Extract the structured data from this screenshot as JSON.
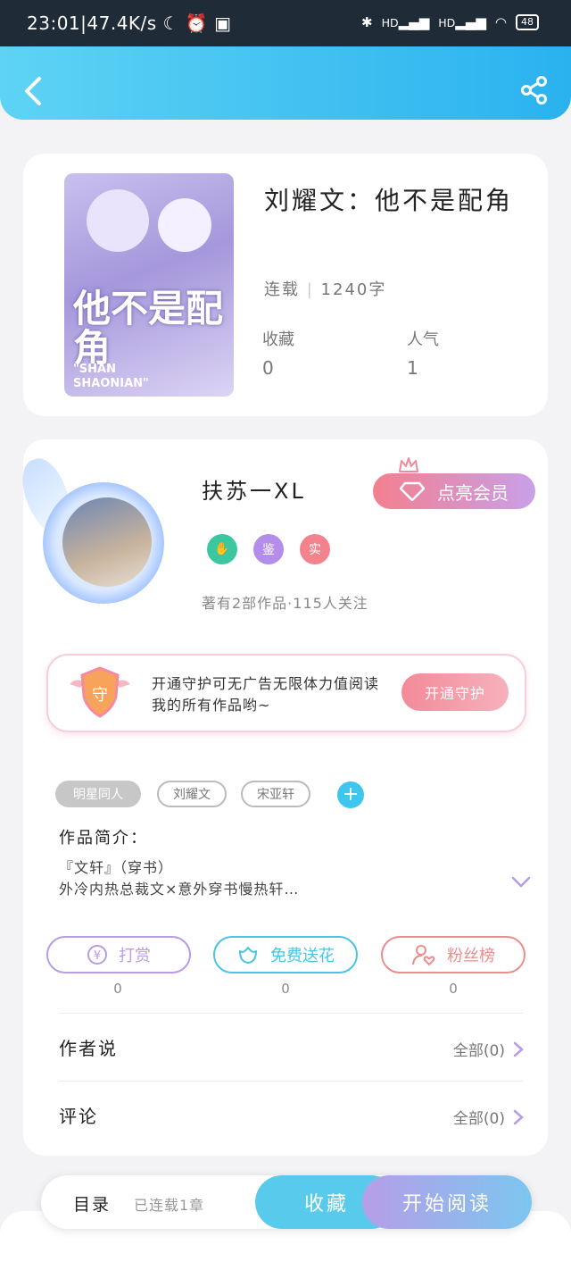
{
  "status_bar": {
    "time": "23:01",
    "speed": "47.4K/s",
    "battery": "48",
    "hd1": "HD",
    "hd2": "HD"
  },
  "book": {
    "title": "刘耀文：他不是配角",
    "status": "连载",
    "words": "1240字",
    "collect_label": "收藏",
    "collect_value": "0",
    "popularity_label": "人气",
    "popularity_value": "1",
    "cover_title": "他不是配角",
    "cover_subtitle_1": "\"SHAN",
    "cover_subtitle_2": "SHAONIAN\""
  },
  "author": {
    "name": "扶苏一XL",
    "vip_button": "点亮会员",
    "badges": [
      "",
      "鉴",
      "实"
    ],
    "works_info": "著有2部作品·115人关注"
  },
  "guard": {
    "text": "开通守护可无广告无限体力值阅读我的所有作品哟~",
    "button": "开通守护",
    "icon_char": "守"
  },
  "tags": [
    "明星同人",
    "刘耀文",
    "宋亚轩"
  ],
  "tag_add": "+",
  "intro": {
    "label": "作品简介：",
    "line1": "『文轩』（穿书）",
    "line2": "外冷内热总裁文×意外穿书慢热轩…"
  },
  "actions": [
    {
      "label": "打赏",
      "count": "0",
      "icon": "yen-coin-icon",
      "color": "#b99be6"
    },
    {
      "label": "免费送花",
      "count": "0",
      "icon": "flower-icon",
      "color": "#49c3e8"
    },
    {
      "label": "粉丝榜",
      "count": "0",
      "icon": "fan-heart-icon",
      "color": "#ee8c8c"
    }
  ],
  "rows": [
    {
      "label": "作者说",
      "more": "全部(0)"
    },
    {
      "label": "评论",
      "more": "全部(0)"
    }
  ],
  "bottom": {
    "toc": "目录",
    "toc_status": "已连载1章",
    "favorite": "收藏",
    "read": "开始阅读"
  },
  "colors": {
    "header": "#2ab2ef",
    "accent_cyan": "#58cbec",
    "vip_pink": "#f47f8f"
  }
}
